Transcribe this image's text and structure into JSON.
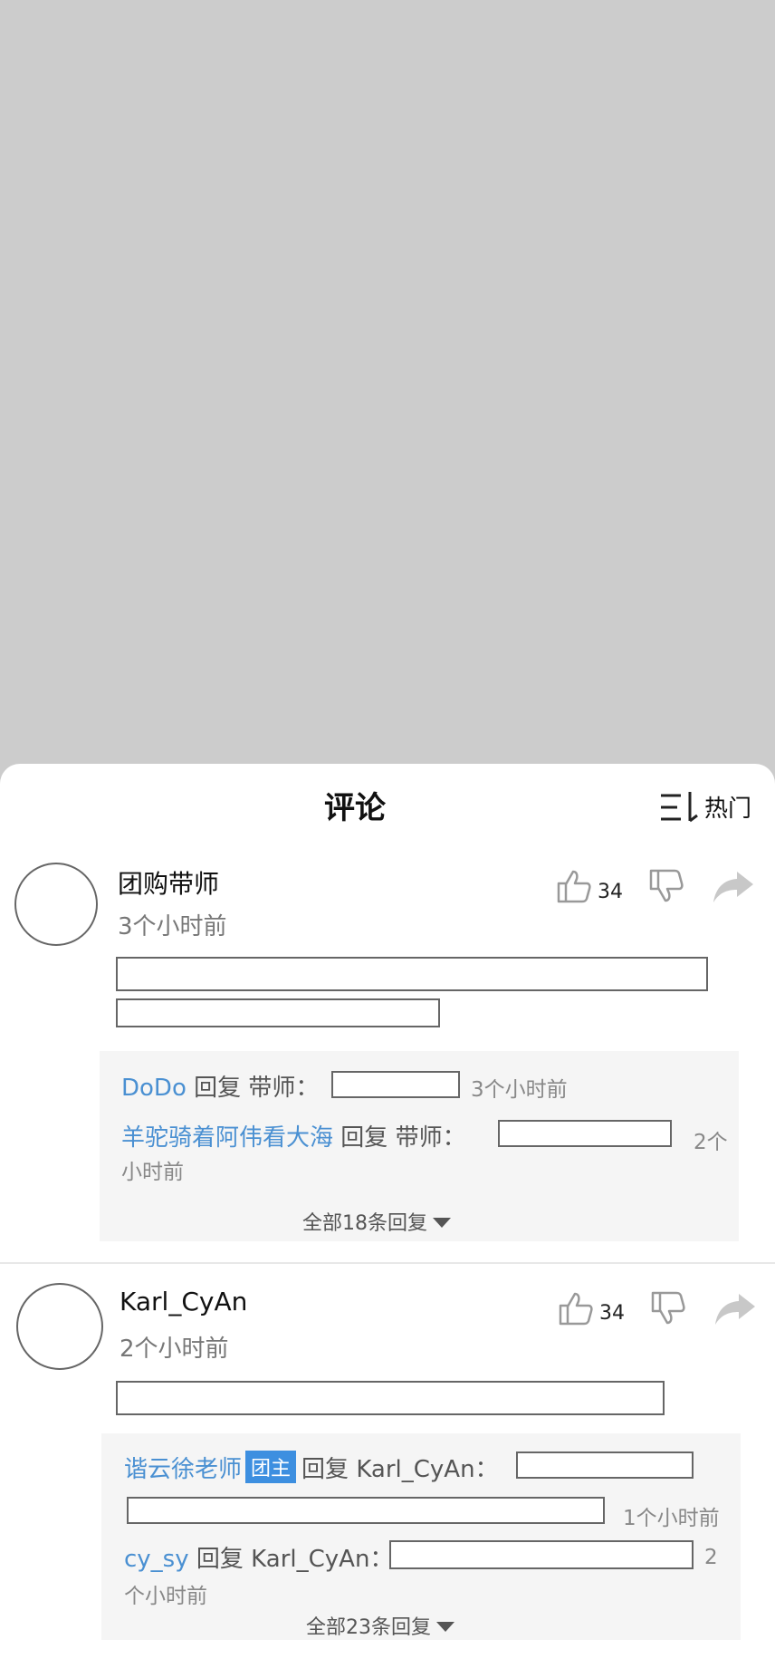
{
  "sheet": {
    "title": "评论",
    "sort_label": "热门"
  },
  "comments": [
    {
      "username": "团购带师",
      "time": "3个小时前",
      "likes": "34",
      "replies": [
        {
          "user": "DoDo",
          "verb": "回复",
          "target": "带师：",
          "time": "3个小时前"
        },
        {
          "user": "羊驼骑着阿伟看大海",
          "verb": "回复",
          "target": "带师：",
          "time_a": "2个",
          "time_b": "小时前"
        }
      ],
      "more_label": "全部18条回复"
    },
    {
      "username": "Karl_CyAn",
      "time": "2个小时前",
      "likes": "34",
      "replies": [
        {
          "user": "谐云徐老师",
          "badge": "团主",
          "verb": "回复",
          "target": "Karl_CyAn：",
          "time": "1个小时前"
        },
        {
          "user": "cy_sy",
          "verb": "回复",
          "target": "Karl_CyAn：",
          "time_a": "2",
          "time_b": "个小时前"
        }
      ],
      "more_label": "全部23条回复"
    }
  ]
}
